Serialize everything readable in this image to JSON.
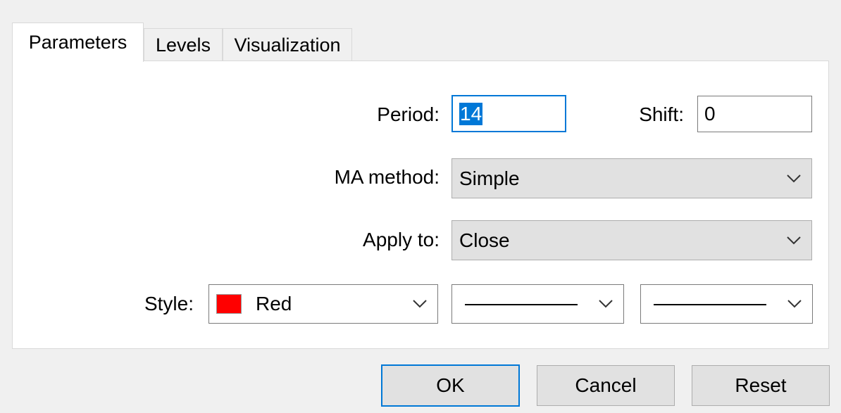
{
  "tabs": [
    {
      "label": "Parameters",
      "active": true
    },
    {
      "label": "Levels",
      "active": false
    },
    {
      "label": "Visualization",
      "active": false
    }
  ],
  "fields": {
    "period_label": "Period:",
    "period_value": "14",
    "shift_label": "Shift:",
    "shift_value": "0",
    "ma_method_label": "MA method:",
    "ma_method_value": "Simple",
    "apply_to_label": "Apply to:",
    "apply_to_value": "Close",
    "style_label": "Style:",
    "style_color_name": "Red",
    "style_color_hex": "#ff0000"
  },
  "buttons": {
    "ok": "OK",
    "cancel": "Cancel",
    "reset": "Reset"
  },
  "colors": {
    "focus_accent": "#0078d7"
  }
}
